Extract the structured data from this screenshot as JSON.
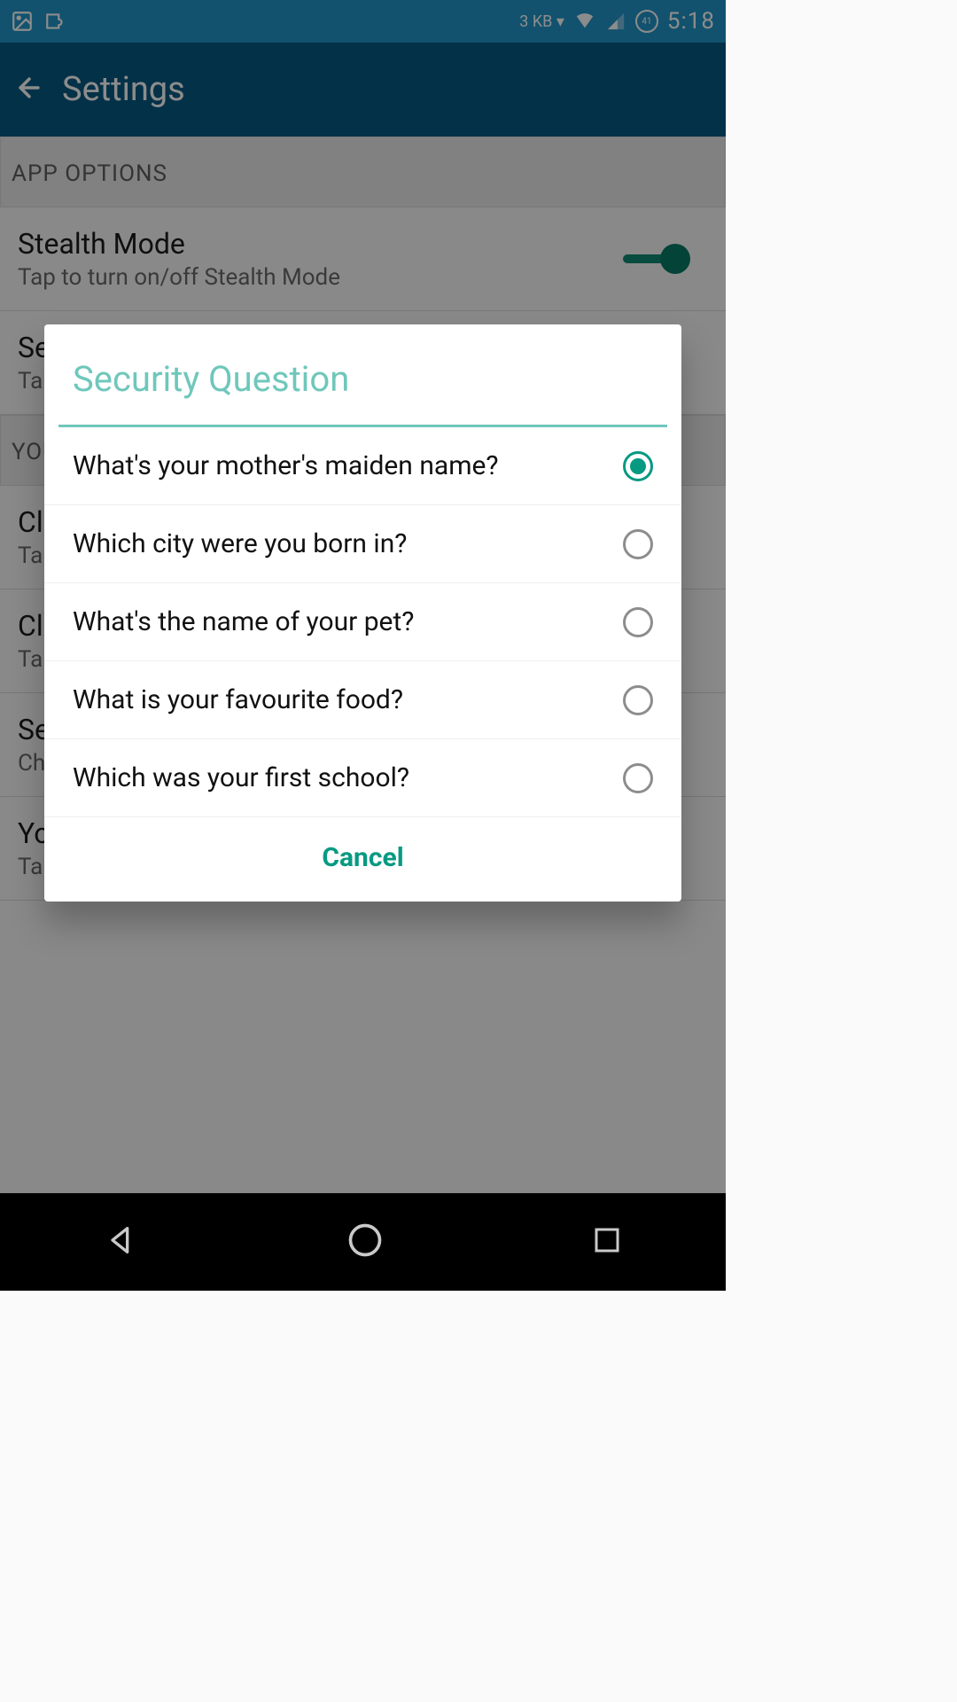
{
  "status_bar": {
    "data_rate": "3 KB ▾",
    "battery_pct": "41",
    "time": "5:18"
  },
  "action_bar": {
    "title": "Settings"
  },
  "sections": {
    "app_options_header": "APP OPTIONS",
    "your_header": "YOU",
    "stealth": {
      "title": "Stealth Mode",
      "subtitle": "Tap to turn on/off Stealth Mode",
      "on": true
    },
    "security_q": {
      "title": "Se",
      "subtitle": "Ta"
    },
    "change1": {
      "title": "Cl",
      "subtitle": "Ta"
    },
    "change2": {
      "title": "Cl",
      "subtitle": "Ta"
    },
    "sec2": {
      "title": "Se",
      "subtitle": "Ch"
    },
    "your": {
      "title": "Yo",
      "subtitle": "Tap to enter your answer"
    }
  },
  "dialog": {
    "title": "Security Question",
    "options": [
      {
        "label": "What's your mother's maiden name?",
        "selected": true
      },
      {
        "label": "Which city were you born in?",
        "selected": false
      },
      {
        "label": "What's the name of your pet?",
        "selected": false
      },
      {
        "label": "What is your favourite food?",
        "selected": false
      },
      {
        "label": "Which was your first school?",
        "selected": false
      }
    ],
    "cancel_label": "Cancel"
  },
  "colors": {
    "status_bg": "#2196c8",
    "action_bg": "#075a83",
    "accent": "#079a82",
    "dialog_title": "#6fc7bb"
  }
}
